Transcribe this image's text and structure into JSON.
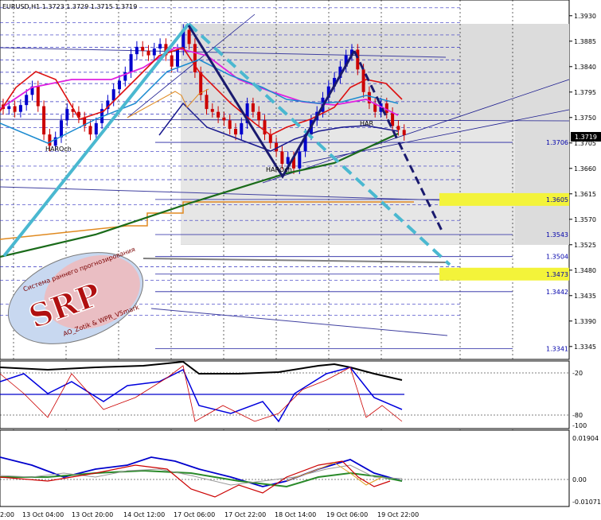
{
  "chart_data": {
    "type": "line",
    "symbol_header": "EURUSD,H1  1.3723 1.3729 1.3715 1.3719",
    "current_price": "1.3719",
    "y_axis": {
      "ylim": [
        1.3325,
        1.3955
      ],
      "ticks": [
        {
          "value": 1.393,
          "label": "1.3930"
        },
        {
          "value": 1.3885,
          "label": "1.3885"
        },
        {
          "value": 1.384,
          "label": "1.3840"
        },
        {
          "value": 1.3795,
          "label": "1.3795"
        },
        {
          "value": 1.375,
          "label": "1.3750"
        },
        {
          "value": 1.3705,
          "label": "1.3705"
        },
        {
          "value": 1.366,
          "label": "1.3660"
        },
        {
          "value": 1.3615,
          "label": "1.3615"
        },
        {
          "value": 1.357,
          "label": "1.3570"
        },
        {
          "value": 1.3525,
          "label": "1.3525"
        },
        {
          "value": 1.348,
          "label": "1.3480"
        },
        {
          "value": 1.3435,
          "label": "1.3435"
        },
        {
          "value": 1.339,
          "label": "1.3390"
        },
        {
          "value": 1.3345,
          "label": "1.3345"
        }
      ]
    },
    "levels": [
      {
        "value": 1.3706,
        "label": "1.3706",
        "highlight": false
      },
      {
        "value": 1.3605,
        "label": "1.3605",
        "highlight": true
      },
      {
        "value": 1.3543,
        "label": "1.3543",
        "highlight": false
      },
      {
        "value": 1.3504,
        "label": "1.3504",
        "highlight": false
      },
      {
        "value": 1.3473,
        "label": "1.3473",
        "highlight": true
      },
      {
        "value": 1.3442,
        "label": "1.3442",
        "highlight": false
      },
      {
        "value": 1.3341,
        "label": "1.3341",
        "highlight": false
      }
    ],
    "x_axis": {
      "ticks": [
        "2:00",
        "13 Oct 04:00",
        "13 Oct 20:00",
        "14 Oct 12:00",
        "17 Oct 06:00",
        "17 Oct 22:00",
        "18 Oct 14:00",
        "19 Oct 06:00",
        "19 Oct 22:00"
      ]
    },
    "annotations": [
      {
        "text": "HAROch"
      },
      {
        "text": "HAROch"
      },
      {
        "text": "HAR"
      }
    ],
    "close_series": [
      1.3765,
      1.377,
      1.376,
      1.3772,
      1.379,
      1.3805,
      1.377,
      1.372,
      1.37,
      1.3715,
      1.3745,
      1.3765,
      1.376,
      1.375,
      1.3735,
      1.372,
      1.374,
      1.3765,
      1.378,
      1.38,
      1.3815,
      1.383,
      1.3862,
      1.3875,
      1.3868,
      1.386,
      1.3872,
      1.388,
      1.386,
      1.384,
      1.387,
      1.3905,
      1.388,
      1.383,
      1.379,
      1.3765,
      1.376,
      1.375,
      1.3745,
      1.373,
      1.372,
      1.374,
      1.3775,
      1.376,
      1.3745,
      1.372,
      1.3705,
      1.369,
      1.3668,
      1.368,
      1.366,
      1.369,
      1.372,
      1.3745,
      1.376,
      1.3785,
      1.3805,
      1.382,
      1.384,
      1.386,
      1.387,
      1.3835,
      1.3795,
      1.3775,
      1.376,
      1.3775,
      1.3758,
      1.3735,
      1.3728,
      1.3719
    ],
    "subwindow_1": {
      "levels": [
        {
          "value": 20,
          "label": "-20"
        },
        {
          "value": 80,
          "label": "-80"
        }
      ],
      "extra_label": "-100"
    },
    "subwindow_2": {
      "ticks": [
        {
          "value": 0.01904,
          "label": "0.01904"
        },
        {
          "value": 0.0,
          "label": "0.00"
        },
        {
          "value": -0.01071,
          "label": "-0.01071"
        }
      ]
    },
    "logo": {
      "top_text": "Система раннего прогнозирования",
      "letters": "SRP",
      "bottom_text": "AO_Zotik & WPR_V5mark"
    }
  },
  "colors": {
    "candle_up": "#0000cc",
    "candle_down": "#cc0000",
    "trend_cyan": "#4ab8d0",
    "trend_navy": "#1a1a6e",
    "highlight_yellow": "#f3f33a",
    "ma_magenta": "#e020e0",
    "ma_red": "#dd1010",
    "ma_green": "#1a6b1a",
    "ma_orange": "#e08a20",
    "zone_gray": "#e0e0e0"
  }
}
